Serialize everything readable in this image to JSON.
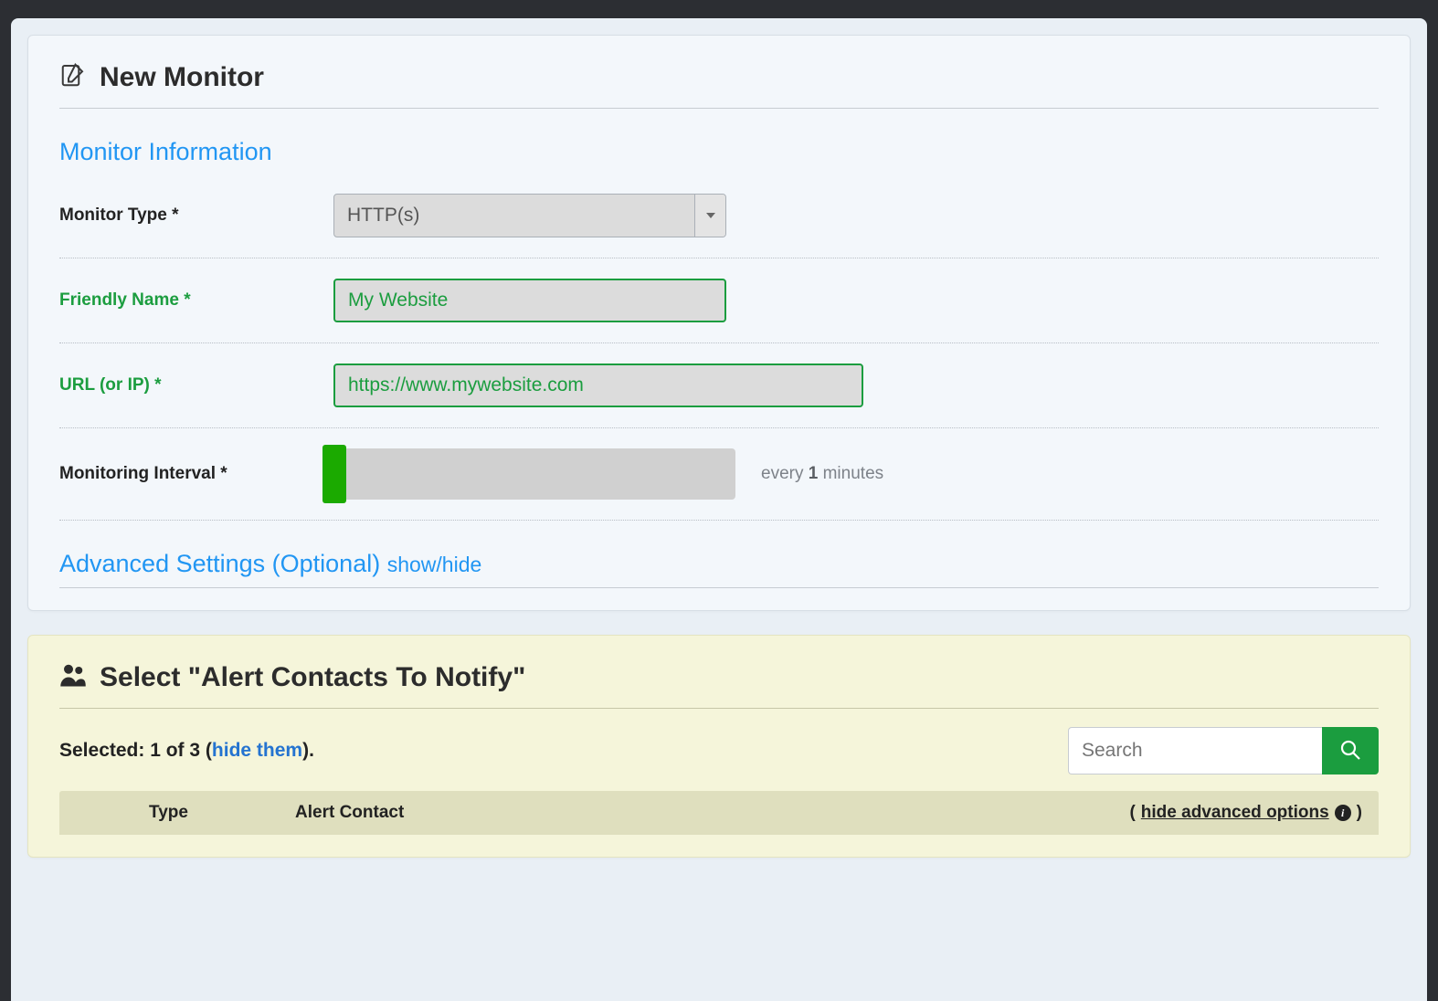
{
  "panel1": {
    "title": "New Monitor",
    "section_heading": "Monitor Information",
    "monitor_type": {
      "label": "Monitor Type *",
      "value": "HTTP(s)"
    },
    "friendly_name": {
      "label": "Friendly Name *",
      "value": "My Website"
    },
    "url": {
      "label": "URL (or IP) *",
      "value": "https://www.mywebsite.com"
    },
    "interval": {
      "label": "Monitoring Interval *",
      "prefix": "every ",
      "value": "1",
      "suffix": " minutes"
    },
    "advanced": {
      "title": "Advanced Settings (Optional) ",
      "toggle": "show/hide"
    }
  },
  "panel2": {
    "title": "Select \"Alert Contacts To Notify\"",
    "selected_prefix": "Selected: ",
    "selected_count": "1 of 3",
    "selected_open": " (",
    "hide_them": "hide them",
    "selected_close": ").",
    "search_placeholder": "Search",
    "table": {
      "type": "Type",
      "contact": "Alert Contact",
      "open_paren": "( ",
      "hide_adv": "hide advanced options",
      "close_paren": " )"
    }
  }
}
